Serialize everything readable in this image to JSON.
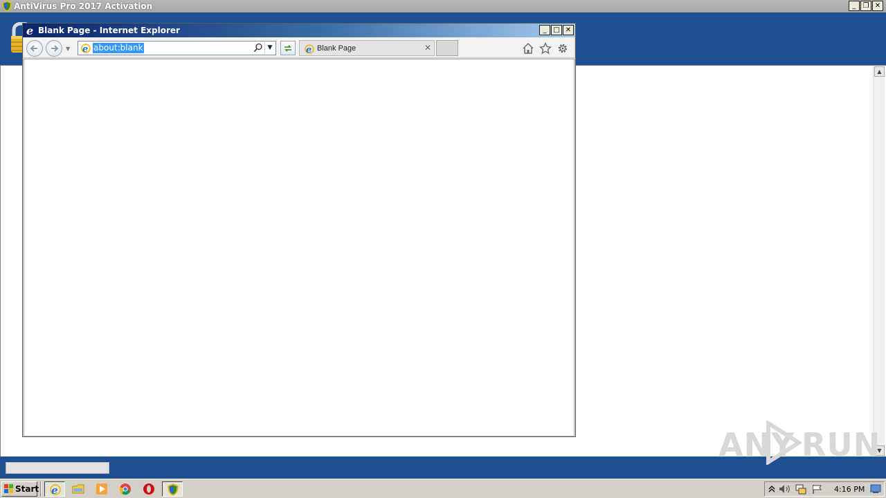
{
  "app": {
    "title": "AntiVirus Pro 2017 Activation"
  },
  "browser": {
    "title": "Blank Page - Internet Explorer",
    "address": "about:blank",
    "tab_label": "Blank Page"
  },
  "watermark": {
    "left": "ANY",
    "right": "RUN"
  },
  "taskbar": {
    "start_label": "Start",
    "clock": "4:16 PM"
  },
  "colors": {
    "app_header": "#1e4f91",
    "ie_title_start": "#0a246a",
    "selection": "#3399ff"
  }
}
